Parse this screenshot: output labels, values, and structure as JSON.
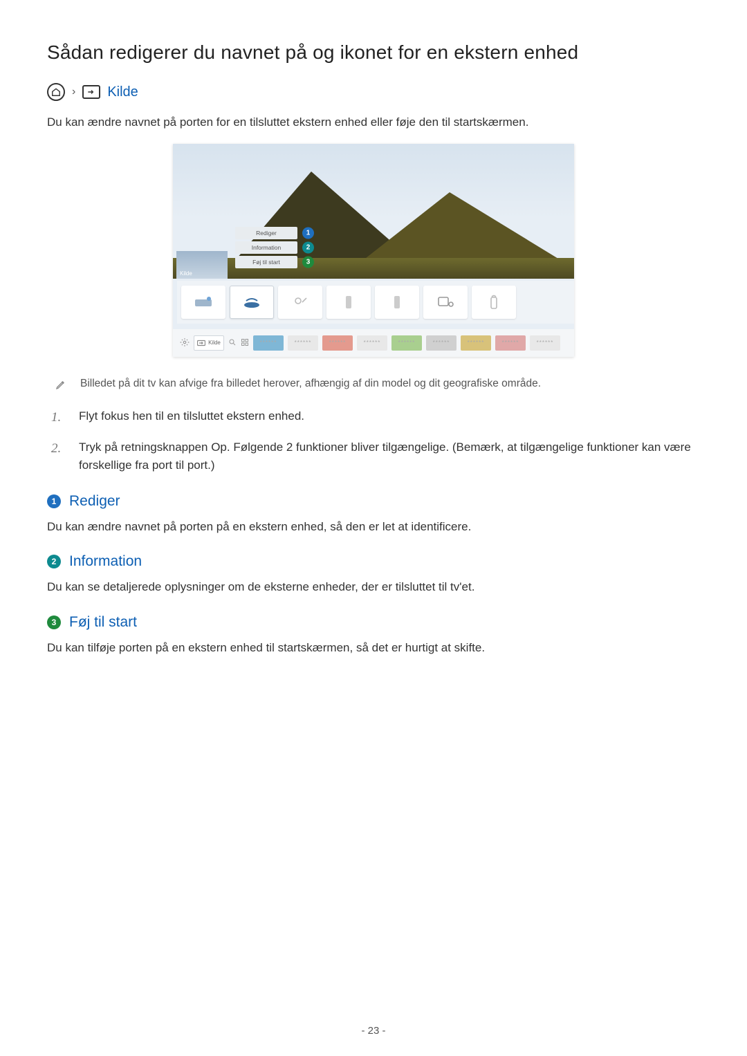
{
  "title": "Sådan redigerer du navnet på og ikonet for en ekstern enhed",
  "breadcrumb": {
    "kilde": "Kilde"
  },
  "intro": "Du kan ændre navnet på porten for en tilsluttet ekstern enhed eller føje den til startskærmen.",
  "tv": {
    "kilde_thumb": "Kilde",
    "popup": [
      {
        "label": "Rediger",
        "num": "1"
      },
      {
        "label": "Information",
        "num": "2"
      },
      {
        "label": "Føj til start",
        "num": "3"
      }
    ],
    "bottom_kilde": "Kilde",
    "placeholder_dots": "******"
  },
  "note": "Billedet på dit tv kan afvige fra billedet herover, afhængig af din model og dit geografiske område.",
  "steps": [
    "Flyt fokus hen til en tilsluttet ekstern enhed.",
    "Tryk på retningsknappen Op. Følgende 2 funktioner bliver tilgængelige. (Bemærk, at tilgængelige funktioner kan være forskellige fra port til port.)"
  ],
  "sections": [
    {
      "num": "1",
      "badge": "c-blue",
      "title": "Rediger",
      "body": "Du kan ændre navnet på porten på en ekstern enhed, så den er let at identificere."
    },
    {
      "num": "2",
      "badge": "c-teal",
      "title": "Information",
      "body": "Du kan se detaljerede oplysninger om de eksterne enheder, der er tilsluttet til tv'et."
    },
    {
      "num": "3",
      "badge": "c-green",
      "title": "Føj til start",
      "body": "Du kan tilføje porten på en ekstern enhed til startskærmen, så det er hurtigt at skifte."
    }
  ],
  "page_number": "- 23 -"
}
